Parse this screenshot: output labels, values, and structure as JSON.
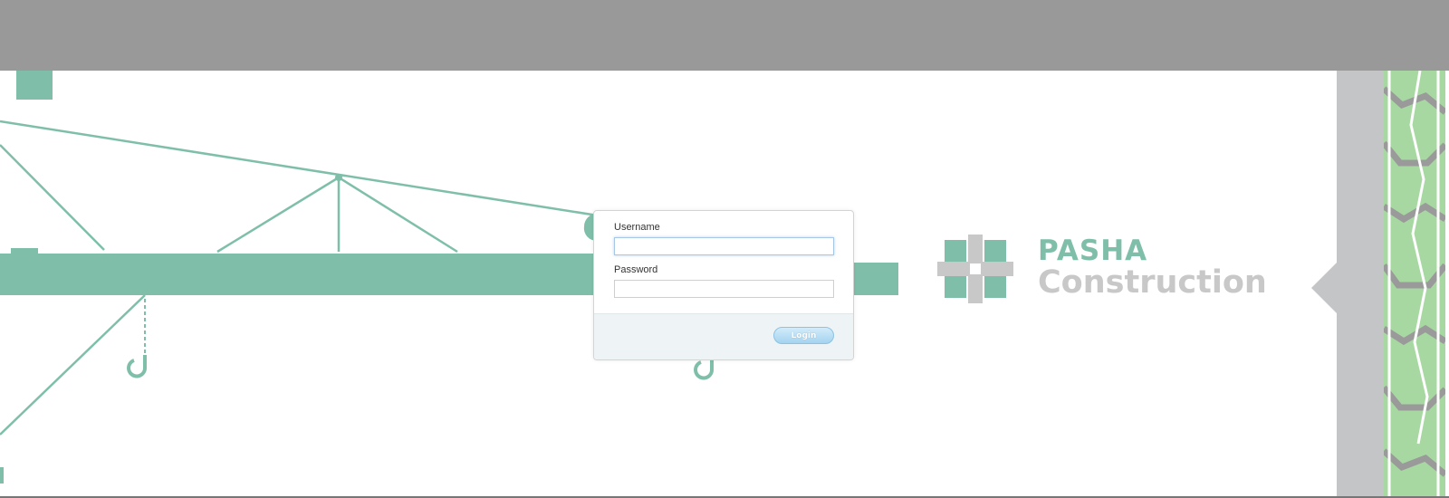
{
  "login": {
    "username_label": "Username",
    "username_value": "",
    "password_label": "Password",
    "password_value": "",
    "button_label": "Login"
  },
  "brand": {
    "line1": "PASHA",
    "line2": "Construction"
  },
  "colors": {
    "crane_green": "#7fbfaa",
    "top_bar_gray": "#999999",
    "side_strip_gray": "#c4c5c7",
    "pattern_green": "#a8d8a2",
    "button_blue": "#a4d3f0"
  },
  "icons": {
    "crane": "crane-illustration",
    "logo": "pasha-star-logo"
  }
}
